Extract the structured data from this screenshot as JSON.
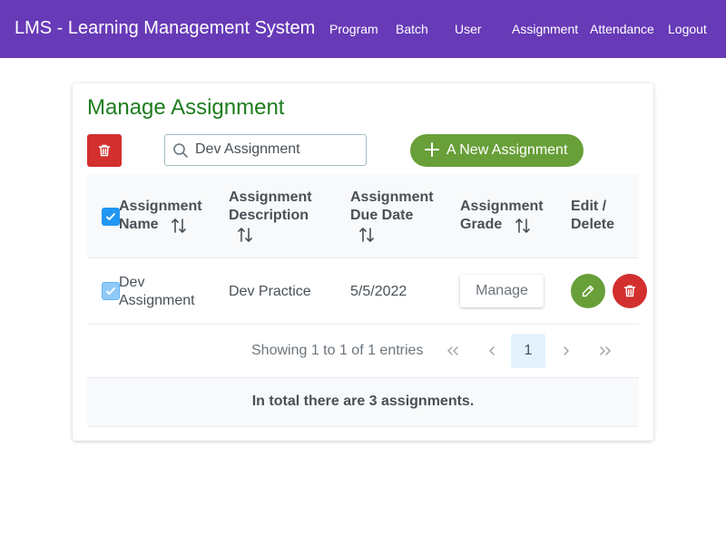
{
  "navbar": {
    "brand": "LMS - Learning Management System",
    "links": [
      "Program",
      "Batch",
      "User",
      "Assignment",
      "Attendance",
      "Logout"
    ]
  },
  "page": {
    "title": "Manage Assignment",
    "search_value": "Dev Assignment",
    "new_button_label": "A New Assignment"
  },
  "table": {
    "headers": [
      {
        "line1": "Assignment",
        "line2": "Name"
      },
      {
        "line1": "Assignment",
        "line2": "Description"
      },
      {
        "line1": "Assignment",
        "line2": "Due Date"
      },
      {
        "line1": "Assignment",
        "line2": "Grade"
      },
      {
        "line1": "Edit /",
        "line2": "Delete"
      }
    ],
    "rows": [
      {
        "name_line1": "Dev",
        "name_line2": "Assignment",
        "description": "Dev Practice",
        "due_date": "5/5/2022",
        "grade_button": "Manage"
      }
    ]
  },
  "paginator": {
    "report": "Showing 1 to 1 of 1 entries",
    "current_page": "1"
  },
  "footer": {
    "text": "In total there are 3 assignments."
  },
  "colors": {
    "navbar": "#673ab7",
    "title": "#1e7d1e",
    "success": "#689f38",
    "danger": "#d32f2f",
    "checkbox": "#2196f3"
  }
}
